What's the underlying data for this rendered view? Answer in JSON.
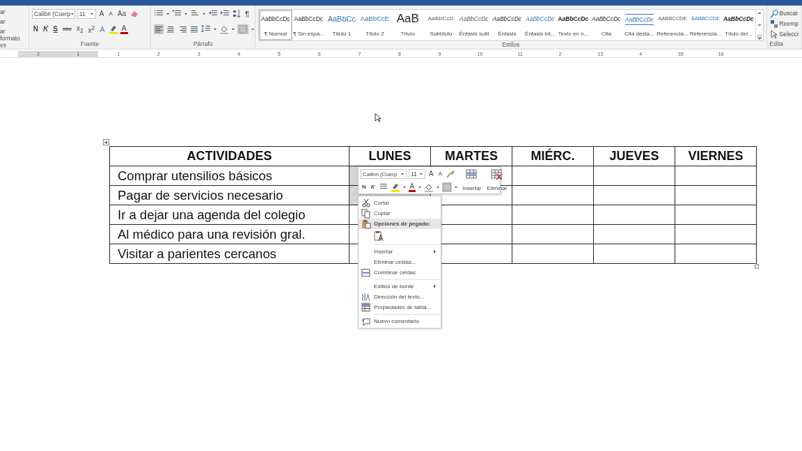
{
  "ribbon": {
    "clipboard": {
      "items": [
        "ar",
        "ar",
        "ar formato"
      ],
      "label": "es"
    },
    "font": {
      "label": "Fuente",
      "font_name": "Calibri (Cuerp",
      "font_size": "11",
      "grow": "A",
      "shrink": "A",
      "case": "Aa",
      "effects": "A",
      "color_letter": "A",
      "format_buttons": [
        {
          "label": "N",
          "kind": "bold"
        },
        {
          "label": "K",
          "kind": "italic"
        },
        {
          "label": "S",
          "kind": "underline"
        },
        {
          "label": "abc",
          "kind": "strike"
        },
        {
          "label": "x$_{2}$",
          "kind": "script"
        },
        {
          "label": "x$^{2}$",
          "kind": "script"
        }
      ]
    },
    "paragraph": {
      "label": "Párrafo",
      "pilcrow": "¶",
      "alignments": [
        {
          "selected": true
        },
        {
          "selected": false
        },
        {
          "selected": false
        },
        {
          "selected": false
        }
      ],
      "borders": {
        "selected": true
      }
    },
    "styles": {
      "label": "Estilos",
      "items": [
        {
          "preview": "AaBbCcDc",
          "name": "¶ Normal",
          "kind": "plain",
          "selected": true
        },
        {
          "preview": "AaBbCcDc",
          "name": "¶ Sin espa...",
          "kind": "plain",
          "selected": false
        },
        {
          "preview": "AaBbCc",
          "name": "Título 1",
          "kind": "heading",
          "selected": false
        },
        {
          "preview": "AaBbCcE",
          "name": "Título 2",
          "kind": "subheading",
          "selected": false
        },
        {
          "preview": "AaB",
          "name": "Título",
          "kind": "title",
          "selected": false
        },
        {
          "preview": "AaBbCcD",
          "name": "Subtítulo",
          "kind": "spaced",
          "selected": false
        },
        {
          "preview": "AaBbCcDc",
          "name": "Énfasis sutil",
          "kind": "italic-grey",
          "selected": false
        },
        {
          "preview": "AaBbCcDc",
          "name": "Énfasis",
          "kind": "italic",
          "selected": false
        },
        {
          "preview": "AaBbCcDc",
          "name": "Énfasis int...",
          "kind": "italic-blue",
          "selected": false
        },
        {
          "preview": "AaBbCcDc",
          "name": "Texto en n...",
          "kind": "bold",
          "selected": false
        },
        {
          "preview": "AaBbCcDc",
          "name": "Cita",
          "kind": "italic",
          "selected": false
        },
        {
          "preview": "AaBbCcDc",
          "name": "Cita desta...",
          "kind": "quote",
          "selected": false
        },
        {
          "preview": "AABBCCDE",
          "name": "Referencia...",
          "kind": "caps",
          "selected": false
        },
        {
          "preview": "AABBCCDE",
          "name": "Referencia...",
          "kind": "caps-blue",
          "selected": false
        },
        {
          "preview": "AaBbCcDc",
          "name": "Título del...",
          "kind": "bold-italic",
          "selected": false
        }
      ]
    },
    "editing": {
      "label": "Edita",
      "items": [
        "Buscar",
        "Reemp",
        "Selecci"
      ]
    }
  },
  "ruler": {
    "labels": [
      "2",
      "1",
      "1",
      "2",
      "3",
      "4",
      "5",
      "6",
      "7",
      "8",
      "9",
      "10",
      "11",
      "2",
      "13",
      "4",
      "15",
      "16"
    ]
  },
  "table": {
    "columns": [
      "ACTIVIDADES",
      "LUNES",
      "MARTES",
      "MIÉRC.",
      "JUEVES",
      "VIERNES"
    ],
    "rows": [
      {
        "activity": "Comprar utensilios básicos",
        "day_cells": [
          {
            "selected": true
          },
          {
            "selected": false
          },
          {
            "selected": false
          },
          {
            "selected": false
          },
          {
            "selected": false
          }
        ]
      },
      {
        "activity": "Pagar de servicios necesario",
        "day_cells": [
          {
            "selected": true
          },
          {
            "selected": false
          },
          {
            "selected": false
          },
          {
            "selected": false
          },
          {
            "selected": false
          }
        ]
      },
      {
        "activity": "Ir a dejar una agenda del colegio",
        "day_cells": [
          {
            "selected": false
          },
          {
            "selected": false
          },
          {
            "selected": false
          },
          {
            "selected": false
          },
          {
            "selected": false
          }
        ]
      },
      {
        "activity": "Al médico para una revisión gral.",
        "day_cells": [
          {
            "selected": false
          },
          {
            "selected": false
          },
          {
            "selected": false
          },
          {
            "selected": false
          },
          {
            "selected": false
          }
        ]
      },
      {
        "activity": "Visitar a parientes cercanos",
        "day_cells": [
          {
            "selected": false
          },
          {
            "selected": false
          },
          {
            "selected": false
          },
          {
            "selected": false
          },
          {
            "selected": false
          }
        ]
      }
    ]
  },
  "mini_toolbar": {
    "font_name": "Calibri (Cuerp",
    "font_size": "11",
    "grow": "A",
    "shrink": "A",
    "bold": "N",
    "italic": "K",
    "color_letter": "A",
    "borders": {
      "selected": true
    },
    "insert_label": "Insertar",
    "delete_label": "Eliminar"
  },
  "context_menu": {
    "items": [
      {
        "kind": "item",
        "label": "Cortar",
        "submenu": false
      },
      {
        "kind": "item",
        "label": "Copiar",
        "submenu": false
      },
      {
        "kind": "header",
        "label": "Opciones de pegado:"
      },
      {
        "kind": "paste"
      },
      {
        "kind": "separator"
      },
      {
        "kind": "item",
        "label": "Insertar",
        "submenu": true
      },
      {
        "kind": "item",
        "label": "Eliminar celdas...",
        "submenu": false
      },
      {
        "kind": "item",
        "label": "Combinar celdas",
        "submenu": false
      },
      {
        "kind": "separator"
      },
      {
        "kind": "item",
        "label": "Estilos de borde",
        "submenu": true
      },
      {
        "kind": "item",
        "label": "Dirección del texto...",
        "submenu": false
      },
      {
        "kind": "item",
        "label": "Propiedades de tabla...",
        "submenu": false
      },
      {
        "kind": "separator"
      },
      {
        "kind": "item",
        "label": "Nuevo comentario",
        "submenu": false
      }
    ]
  }
}
